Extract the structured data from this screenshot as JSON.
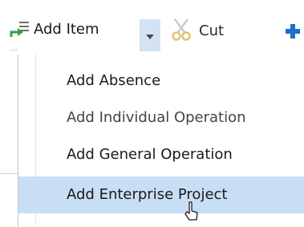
{
  "toolbar": {
    "add_item_label": "Add Item",
    "add_item_icon": "add-item-icon",
    "dropdown_icon": "chevron-down-icon",
    "cut_label": "Cut",
    "cut_icon": "scissors-icon",
    "next_icon": "plus-icon"
  },
  "menu": {
    "items": [
      {
        "label": "Add Absence"
      },
      {
        "label": "Add Individual Operation"
      },
      {
        "label": "Add General Operation"
      },
      {
        "label": "Add Enterprise Project"
      }
    ],
    "highlighted_index": 3
  },
  "colors": {
    "highlight": "#c7def5",
    "arrow_bg": "#d3e3f3",
    "icon_green": "#2ea043",
    "icon_blue": "#1e6fc7"
  }
}
